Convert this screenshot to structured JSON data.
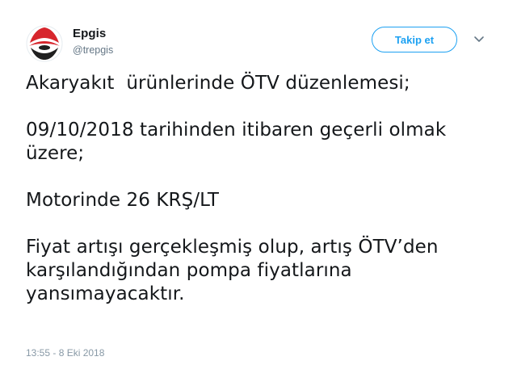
{
  "user": {
    "display_name": "Epgis",
    "handle": "@trepgis"
  },
  "follow_button": {
    "label": "Takip et"
  },
  "tweet": {
    "paragraphs": [
      "Akaryakıt  ürünlerinde ÖTV düzenlemesi;",
      "09/10/2018 tarihinden itibaren geçerli olmak üzere;",
      "Motorinde 26 KRŞ/LT",
      "Fiyat artışı gerçekleşmiş olup, artış ÖTV’den karşılandığından pompa fiyatlarına yansımayacaktır."
    ],
    "timestamp": "13:55 - 8 Eki 2018"
  },
  "icons": {
    "avatar": "epgis-logo-icon",
    "more": "chevron-down-icon"
  },
  "colors": {
    "accent": "#1da1f2",
    "logo_red": "#d7262d",
    "logo_dark": "#1f1f1f",
    "secondary_text": "#657786"
  }
}
